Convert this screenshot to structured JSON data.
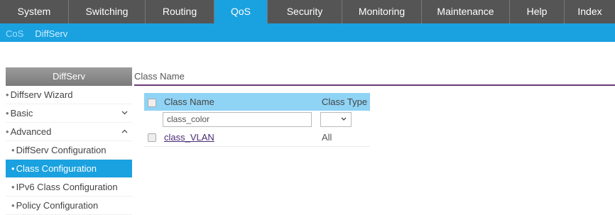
{
  "topnav": {
    "tabs": [
      {
        "label": "System",
        "active": false
      },
      {
        "label": "Switching",
        "active": false
      },
      {
        "label": "Routing",
        "active": false
      },
      {
        "label": "QoS",
        "active": true
      },
      {
        "label": "Security",
        "active": false
      },
      {
        "label": "Monitoring",
        "active": false
      },
      {
        "label": "Maintenance",
        "active": false
      },
      {
        "label": "Help",
        "active": false
      },
      {
        "label": "Index",
        "active": false
      }
    ]
  },
  "subnav": {
    "items": [
      "CoS",
      "DiffServ"
    ]
  },
  "sidebar": {
    "title": "DiffServ",
    "items": [
      {
        "label": "Diffserv Wizard",
        "chevron": ""
      },
      {
        "label": "Basic",
        "chevron": "v"
      },
      {
        "label": "Advanced",
        "chevron": "^"
      },
      {
        "label": "DiffServ Configuration",
        "chevron": ""
      },
      {
        "label": "Class Configuration",
        "chevron": ""
      },
      {
        "label": "IPv6 Class Configuration",
        "chevron": ""
      },
      {
        "label": "Policy Configuration",
        "chevron": ""
      }
    ]
  },
  "content": {
    "title": "Class Name",
    "table": {
      "headers": [
        "Class Name",
        "Class Type"
      ],
      "input_value": "class_color",
      "rows": [
        {
          "name": "class_VLAN",
          "type": "All"
        }
      ]
    }
  }
}
